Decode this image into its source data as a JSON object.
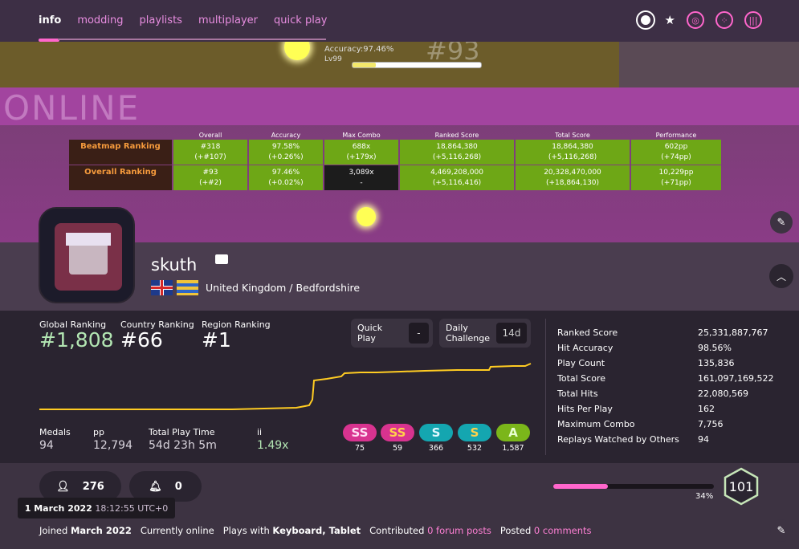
{
  "nav": {
    "tabs": [
      "info",
      "modding",
      "playlists",
      "multiplayer",
      "quick play"
    ],
    "icons": [
      "osu-mode-icon",
      "star-icon",
      "taiko-icon",
      "catch-icon",
      "mania-icon"
    ]
  },
  "cover": {
    "accuracy_text": "Accuracy:97.46%",
    "level_text": "Lv99",
    "rank_text": "#93",
    "online_text": "ONLINE",
    "hp_fill_fraction": 0.18
  },
  "rank_table": {
    "headers": [
      "Overall",
      "Accuracy",
      "Max Combo",
      "Ranked Score",
      "Total Score",
      "Performance"
    ],
    "rows": [
      {
        "label": "Beatmap Ranking",
        "cells": [
          [
            "#318",
            "(+#107)"
          ],
          [
            "97.58%",
            "(+0.26%)"
          ],
          [
            "688x",
            "(+179x)"
          ],
          [
            "18,864,380",
            "(+5,116,268)"
          ],
          [
            "18,864,380",
            "(+5,116,268)"
          ],
          [
            "602pp",
            "(+74pp)"
          ]
        ]
      },
      {
        "label": "Overall Ranking",
        "cells": [
          [
            "#93",
            "(+#2)"
          ],
          [
            "97.46%",
            "(+0.02%)"
          ],
          [
            "3,089x",
            "-"
          ],
          [
            "4,469,208,000",
            "(+5,116,416)"
          ],
          [
            "20,328,470,000",
            "(+18,864,130)"
          ],
          [
            "10,229pp",
            "(+71pp)"
          ]
        ]
      }
    ]
  },
  "profile": {
    "username": "skuth",
    "location": "United Kingdom / Bedfordshire"
  },
  "rankings": {
    "global_label": "Global Ranking",
    "global_value": "#1,808",
    "country_label": "Country Ranking",
    "country_value": "#66",
    "region_label": "Region Ranking",
    "region_value": "#1"
  },
  "quick_play": {
    "label": "Quick Play",
    "value": "-"
  },
  "daily": {
    "label_1": "Daily",
    "label_2": "Challenge",
    "value": "14d"
  },
  "small_stats": {
    "medals_label": "Medals",
    "medals_value": "94",
    "pp_label": "pp",
    "pp_value": "12,794",
    "playtime_label": "Total Play Time",
    "playtime_value": "54d 23h 5m",
    "ii_label": "ii",
    "ii_value": "1.49x"
  },
  "grades": [
    {
      "label": "SS",
      "count": "75",
      "bg": "#d8338f",
      "fg": "#ffe0f4"
    },
    {
      "label": "SS",
      "count": "59",
      "bg": "#d8338f",
      "fg": "#ffd24a"
    },
    {
      "label": "S",
      "count": "366",
      "bg": "#14a6b0",
      "fg": "#e0f8ff"
    },
    {
      "label": "S",
      "count": "532",
      "bg": "#14a6b0",
      "fg": "#ffd24a"
    },
    {
      "label": "A",
      "count": "1,587",
      "bg": "#7bb61a",
      "fg": "#e8ffd0"
    }
  ],
  "stat_list": [
    {
      "label": "Ranked Score",
      "value": "25,331,887,767"
    },
    {
      "label": "Hit Accuracy",
      "value": "98.56%"
    },
    {
      "label": "Play Count",
      "value": "135,836"
    },
    {
      "label": "Total Score",
      "value": "161,097,169,522"
    },
    {
      "label": "Total Hits",
      "value": "22,080,569"
    },
    {
      "label": "Hits Per Play",
      "value": "162"
    },
    {
      "label": "Maximum Combo",
      "value": "7,756"
    },
    {
      "label": "Replays Watched by Others",
      "value": "94"
    }
  ],
  "footer": {
    "followers": "276",
    "subscribers": "0",
    "level_progress_text": "34%",
    "level_progress_fraction": 0.34,
    "level": "101",
    "tooltip_date": "1 March 2022",
    "tooltip_time": "18:12:55 UTC+0",
    "joined_prefix": "Joined",
    "joined_date": "March 2022",
    "online_text": "Currently online",
    "plays_prefix": "Plays with",
    "plays_with": "Keyboard, Tablet",
    "contributed_prefix": "Contributed",
    "forum_posts": "0 forum posts",
    "posted_prefix": "Posted",
    "comments": "0 comments"
  },
  "colors": {
    "accent": "#ff66cc",
    "green": "#6ea716",
    "graph": "#ffcc22"
  }
}
